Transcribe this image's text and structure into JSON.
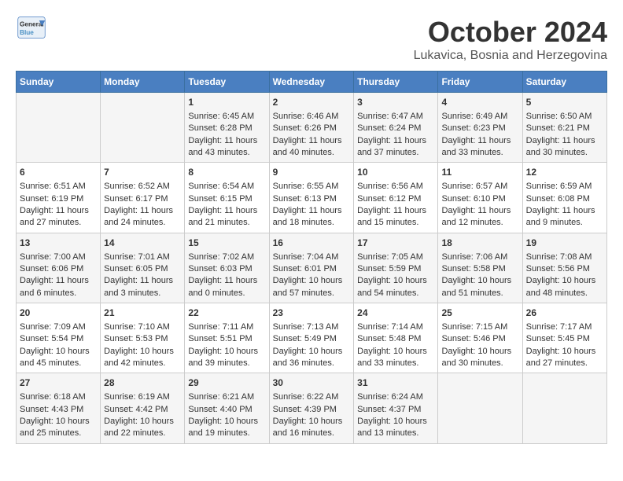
{
  "header": {
    "logo_line1": "General",
    "logo_line2": "Blue",
    "month": "October 2024",
    "location": "Lukavica, Bosnia and Herzegovina"
  },
  "weekdays": [
    "Sunday",
    "Monday",
    "Tuesday",
    "Wednesday",
    "Thursday",
    "Friday",
    "Saturday"
  ],
  "weeks": [
    [
      {
        "day": "",
        "content": ""
      },
      {
        "day": "",
        "content": ""
      },
      {
        "day": "1",
        "content": "Sunrise: 6:45 AM\nSunset: 6:28 PM\nDaylight: 11 hours and 43 minutes."
      },
      {
        "day": "2",
        "content": "Sunrise: 6:46 AM\nSunset: 6:26 PM\nDaylight: 11 hours and 40 minutes."
      },
      {
        "day": "3",
        "content": "Sunrise: 6:47 AM\nSunset: 6:24 PM\nDaylight: 11 hours and 37 minutes."
      },
      {
        "day": "4",
        "content": "Sunrise: 6:49 AM\nSunset: 6:23 PM\nDaylight: 11 hours and 33 minutes."
      },
      {
        "day": "5",
        "content": "Sunrise: 6:50 AM\nSunset: 6:21 PM\nDaylight: 11 hours and 30 minutes."
      }
    ],
    [
      {
        "day": "6",
        "content": "Sunrise: 6:51 AM\nSunset: 6:19 PM\nDaylight: 11 hours and 27 minutes."
      },
      {
        "day": "7",
        "content": "Sunrise: 6:52 AM\nSunset: 6:17 PM\nDaylight: 11 hours and 24 minutes."
      },
      {
        "day": "8",
        "content": "Sunrise: 6:54 AM\nSunset: 6:15 PM\nDaylight: 11 hours and 21 minutes."
      },
      {
        "day": "9",
        "content": "Sunrise: 6:55 AM\nSunset: 6:13 PM\nDaylight: 11 hours and 18 minutes."
      },
      {
        "day": "10",
        "content": "Sunrise: 6:56 AM\nSunset: 6:12 PM\nDaylight: 11 hours and 15 minutes."
      },
      {
        "day": "11",
        "content": "Sunrise: 6:57 AM\nSunset: 6:10 PM\nDaylight: 11 hours and 12 minutes."
      },
      {
        "day": "12",
        "content": "Sunrise: 6:59 AM\nSunset: 6:08 PM\nDaylight: 11 hours and 9 minutes."
      }
    ],
    [
      {
        "day": "13",
        "content": "Sunrise: 7:00 AM\nSunset: 6:06 PM\nDaylight: 11 hours and 6 minutes."
      },
      {
        "day": "14",
        "content": "Sunrise: 7:01 AM\nSunset: 6:05 PM\nDaylight: 11 hours and 3 minutes."
      },
      {
        "day": "15",
        "content": "Sunrise: 7:02 AM\nSunset: 6:03 PM\nDaylight: 11 hours and 0 minutes."
      },
      {
        "day": "16",
        "content": "Sunrise: 7:04 AM\nSunset: 6:01 PM\nDaylight: 10 hours and 57 minutes."
      },
      {
        "day": "17",
        "content": "Sunrise: 7:05 AM\nSunset: 5:59 PM\nDaylight: 10 hours and 54 minutes."
      },
      {
        "day": "18",
        "content": "Sunrise: 7:06 AM\nSunset: 5:58 PM\nDaylight: 10 hours and 51 minutes."
      },
      {
        "day": "19",
        "content": "Sunrise: 7:08 AM\nSunset: 5:56 PM\nDaylight: 10 hours and 48 minutes."
      }
    ],
    [
      {
        "day": "20",
        "content": "Sunrise: 7:09 AM\nSunset: 5:54 PM\nDaylight: 10 hours and 45 minutes."
      },
      {
        "day": "21",
        "content": "Sunrise: 7:10 AM\nSunset: 5:53 PM\nDaylight: 10 hours and 42 minutes."
      },
      {
        "day": "22",
        "content": "Sunrise: 7:11 AM\nSunset: 5:51 PM\nDaylight: 10 hours and 39 minutes."
      },
      {
        "day": "23",
        "content": "Sunrise: 7:13 AM\nSunset: 5:49 PM\nDaylight: 10 hours and 36 minutes."
      },
      {
        "day": "24",
        "content": "Sunrise: 7:14 AM\nSunset: 5:48 PM\nDaylight: 10 hours and 33 minutes."
      },
      {
        "day": "25",
        "content": "Sunrise: 7:15 AM\nSunset: 5:46 PM\nDaylight: 10 hours and 30 minutes."
      },
      {
        "day": "26",
        "content": "Sunrise: 7:17 AM\nSunset: 5:45 PM\nDaylight: 10 hours and 27 minutes."
      }
    ],
    [
      {
        "day": "27",
        "content": "Sunrise: 6:18 AM\nSunset: 4:43 PM\nDaylight: 10 hours and 25 minutes."
      },
      {
        "day": "28",
        "content": "Sunrise: 6:19 AM\nSunset: 4:42 PM\nDaylight: 10 hours and 22 minutes."
      },
      {
        "day": "29",
        "content": "Sunrise: 6:21 AM\nSunset: 4:40 PM\nDaylight: 10 hours and 19 minutes."
      },
      {
        "day": "30",
        "content": "Sunrise: 6:22 AM\nSunset: 4:39 PM\nDaylight: 10 hours and 16 minutes."
      },
      {
        "day": "31",
        "content": "Sunrise: 6:24 AM\nSunset: 4:37 PM\nDaylight: 10 hours and 13 minutes."
      },
      {
        "day": "",
        "content": ""
      },
      {
        "day": "",
        "content": ""
      }
    ]
  ]
}
